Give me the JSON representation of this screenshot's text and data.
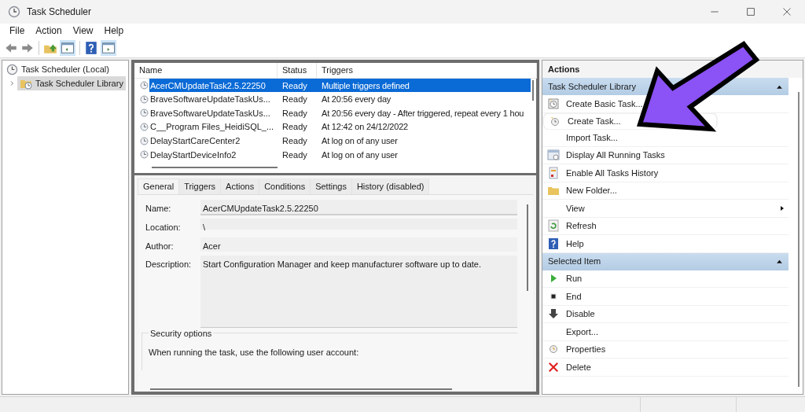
{
  "window": {
    "title": "Task Scheduler"
  },
  "menu": [
    "File",
    "Action",
    "View",
    "Help"
  ],
  "tree": {
    "label": "Task Scheduler (Local)",
    "children": [
      {
        "label": "Task Scheduler Library",
        "selected": true,
        "expanded": false
      }
    ]
  },
  "task_list": {
    "columns": [
      "Name",
      "Status",
      "Triggers"
    ],
    "rows": [
      {
        "name": "AcerCMUpdateTask2.5.22250",
        "status": "Ready",
        "triggers": "Multiple triggers defined",
        "selected": true
      },
      {
        "name": "BraveSoftwareUpdateTaskUs...",
        "status": "Ready",
        "triggers": "At 20:56 every day",
        "selected": false
      },
      {
        "name": "BraveSoftwareUpdateTaskUs...",
        "status": "Ready",
        "triggers": "At 20:56 every day - After triggered, repeat every 1 hou",
        "selected": false
      },
      {
        "name": "C__Program Files_HeidiSQL_...",
        "status": "Ready",
        "triggers": "At 12:42 on 24/12/2022",
        "selected": false
      },
      {
        "name": "DelayStartCareCenter2",
        "status": "Ready",
        "triggers": "At log on of any user",
        "selected": false
      },
      {
        "name": "DelayStartDeviceInfo2",
        "status": "Ready",
        "triggers": "At log on of any user",
        "selected": false
      }
    ]
  },
  "detail_tabs": [
    {
      "label": "General",
      "selected": true
    },
    {
      "label": "Triggers",
      "selected": false
    },
    {
      "label": "Actions",
      "selected": false
    },
    {
      "label": "Conditions",
      "selected": false
    },
    {
      "label": "Settings",
      "selected": false
    },
    {
      "label": "History (disabled)",
      "selected": false
    }
  ],
  "general": {
    "name_label": "Name:",
    "name": "AcerCMUpdateTask2.5.22250",
    "location_label": "Location:",
    "location": "\\",
    "author_label": "Author:",
    "author": "Acer",
    "description_label": "Description:",
    "description": "Start Configuration Manager and keep manufacturer software up to date.",
    "security_title": "Security options",
    "security_text": "When running the task, use the following user account:"
  },
  "actions": {
    "title": "Actions",
    "sections": [
      {
        "title": "Task Scheduler Library",
        "expanded": true,
        "items": [
          {
            "label": "Create Basic Task...",
            "kind": "wizard",
            "highlighted": false
          },
          {
            "label": "Create Task...",
            "kind": "task",
            "highlighted": true
          },
          {
            "label": "Import Task...",
            "kind": "plain",
            "highlighted": false
          },
          {
            "label": "Display All Running Tasks",
            "kind": "running",
            "highlighted": false
          },
          {
            "label": "Enable All Tasks History",
            "kind": "history",
            "highlighted": false
          },
          {
            "label": "New Folder...",
            "kind": "folder",
            "highlighted": false
          },
          {
            "label": "View",
            "kind": "submenu",
            "highlighted": false
          },
          {
            "label": "Refresh",
            "kind": "refresh",
            "highlighted": false
          },
          {
            "label": "Help",
            "kind": "help",
            "highlighted": false
          }
        ]
      },
      {
        "title": "Selected Item",
        "expanded": true,
        "items": [
          {
            "label": "Run",
            "kind": "run",
            "highlighted": false
          },
          {
            "label": "End",
            "kind": "end",
            "highlighted": false
          },
          {
            "label": "Disable",
            "kind": "disable",
            "highlighted": false
          },
          {
            "label": "Export...",
            "kind": "plain",
            "highlighted": false
          },
          {
            "label": "Properties",
            "kind": "properties",
            "highlighted": false
          },
          {
            "label": "Delete",
            "kind": "delete",
            "highlighted": false
          }
        ]
      }
    ]
  }
}
